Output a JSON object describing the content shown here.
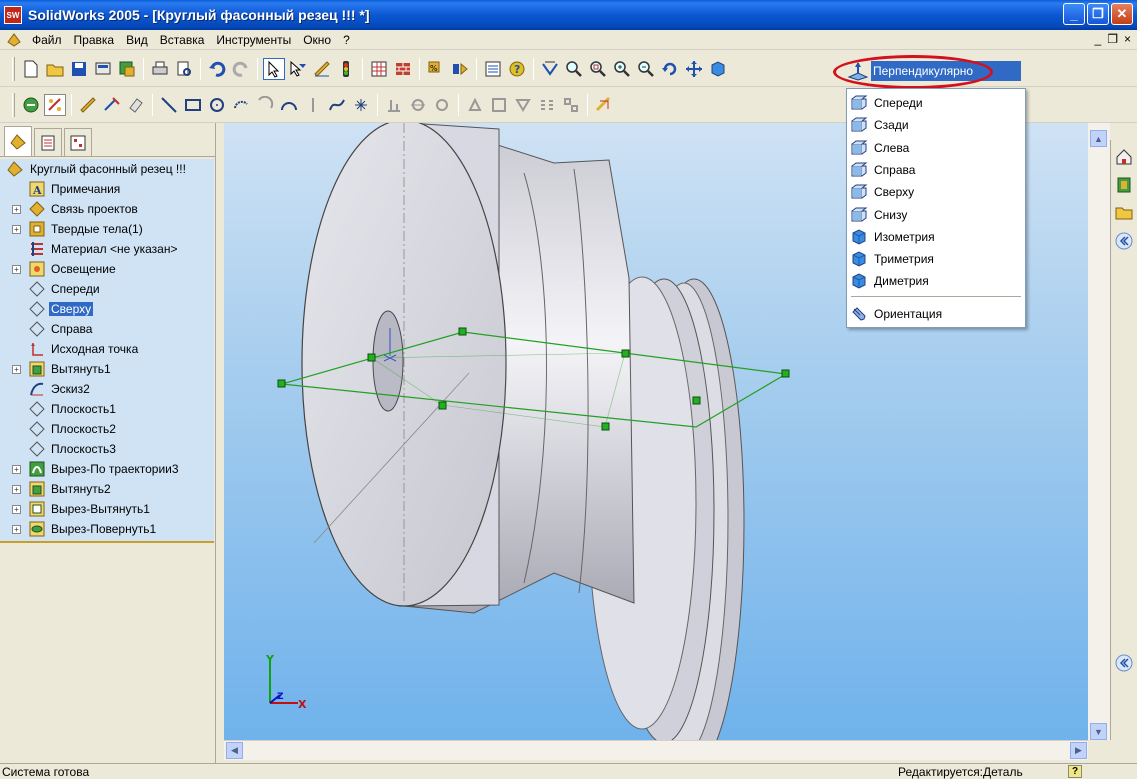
{
  "window": {
    "title": "SolidWorks 2005 - [Круглый фасонный резец !!! *]",
    "app_logo_text": "SW",
    "minimize": "_",
    "maximize": "❐",
    "close": "✕"
  },
  "menubar": {
    "items": [
      "Файл",
      "Правка",
      "Вид",
      "Вставка",
      "Инструменты",
      "Окно",
      "?"
    ],
    "mdi_minimize": "_",
    "mdi_restore": "❐",
    "mdi_close": "×"
  },
  "view_orientation": {
    "current": "Перпендикулярно",
    "items": [
      {
        "label": "Спереди",
        "icon": "cube-front-icon"
      },
      {
        "label": "Сзади",
        "icon": "cube-back-icon"
      },
      {
        "label": "Слева",
        "icon": "cube-left-icon"
      },
      {
        "label": "Справа",
        "icon": "cube-right-icon"
      },
      {
        "label": "Сверху",
        "icon": "cube-top-icon"
      },
      {
        "label": "Снизу",
        "icon": "cube-bottom-icon"
      },
      {
        "label": "Изометрия",
        "icon": "cube-isometric-icon"
      },
      {
        "label": "Триметрия",
        "icon": "cube-trimetric-icon"
      },
      {
        "label": "Диметрия",
        "icon": "cube-dimetric-icon"
      }
    ],
    "orientation_item": "Ориентация"
  },
  "feature_tree": {
    "root": "Круглый фасонный резец !!!",
    "items": [
      {
        "label": "Примечания",
        "icon": "annotations-icon",
        "expandable": false
      },
      {
        "label": "Связь проектов",
        "icon": "design-binder-icon",
        "expandable": true
      },
      {
        "label": "Твердые тела(1)",
        "icon": "solid-bodies-icon",
        "expandable": true
      },
      {
        "label": "Материал <не указан>",
        "icon": "material-icon",
        "expandable": false
      },
      {
        "label": "Освещение",
        "icon": "lighting-icon",
        "expandable": true
      },
      {
        "label": "Спереди",
        "icon": "plane-icon",
        "expandable": false
      },
      {
        "label": "Сверху",
        "icon": "plane-icon",
        "expandable": false,
        "selected": true
      },
      {
        "label": "Справа",
        "icon": "plane-icon",
        "expandable": false
      },
      {
        "label": "Исходная точка",
        "icon": "origin-icon",
        "expandable": false
      },
      {
        "label": "Вытянуть1",
        "icon": "extrude-icon",
        "expandable": true
      },
      {
        "label": "Эскиз2",
        "icon": "sketch-icon",
        "expandable": false
      },
      {
        "label": "Плоскость1",
        "icon": "plane-icon",
        "expandable": false
      },
      {
        "label": "Плоскость2",
        "icon": "plane-icon",
        "expandable": false
      },
      {
        "label": "Плоскость3",
        "icon": "plane-icon",
        "expandable": false
      },
      {
        "label": "Вырез-По траектории3",
        "icon": "sweep-cut-icon",
        "expandable": true
      },
      {
        "label": "Вытянуть2",
        "icon": "extrude-icon",
        "expandable": true
      },
      {
        "label": "Вырез-Вытянуть1",
        "icon": "extrude-cut-icon",
        "expandable": true
      },
      {
        "label": "Вырез-Повернуть1",
        "icon": "revolve-cut-icon",
        "expandable": true
      }
    ]
  },
  "triad": {
    "x": "X",
    "y": "Y",
    "z": "Z"
  },
  "statusbar": {
    "left": "Система готова",
    "right": "Редактируется:Деталь",
    "help": "?"
  },
  "colors": {
    "selection": "#316ac5",
    "tree_background": "#cfe3f5",
    "highlight_ring": "#d4101a",
    "plane_outline": "#22a022"
  }
}
